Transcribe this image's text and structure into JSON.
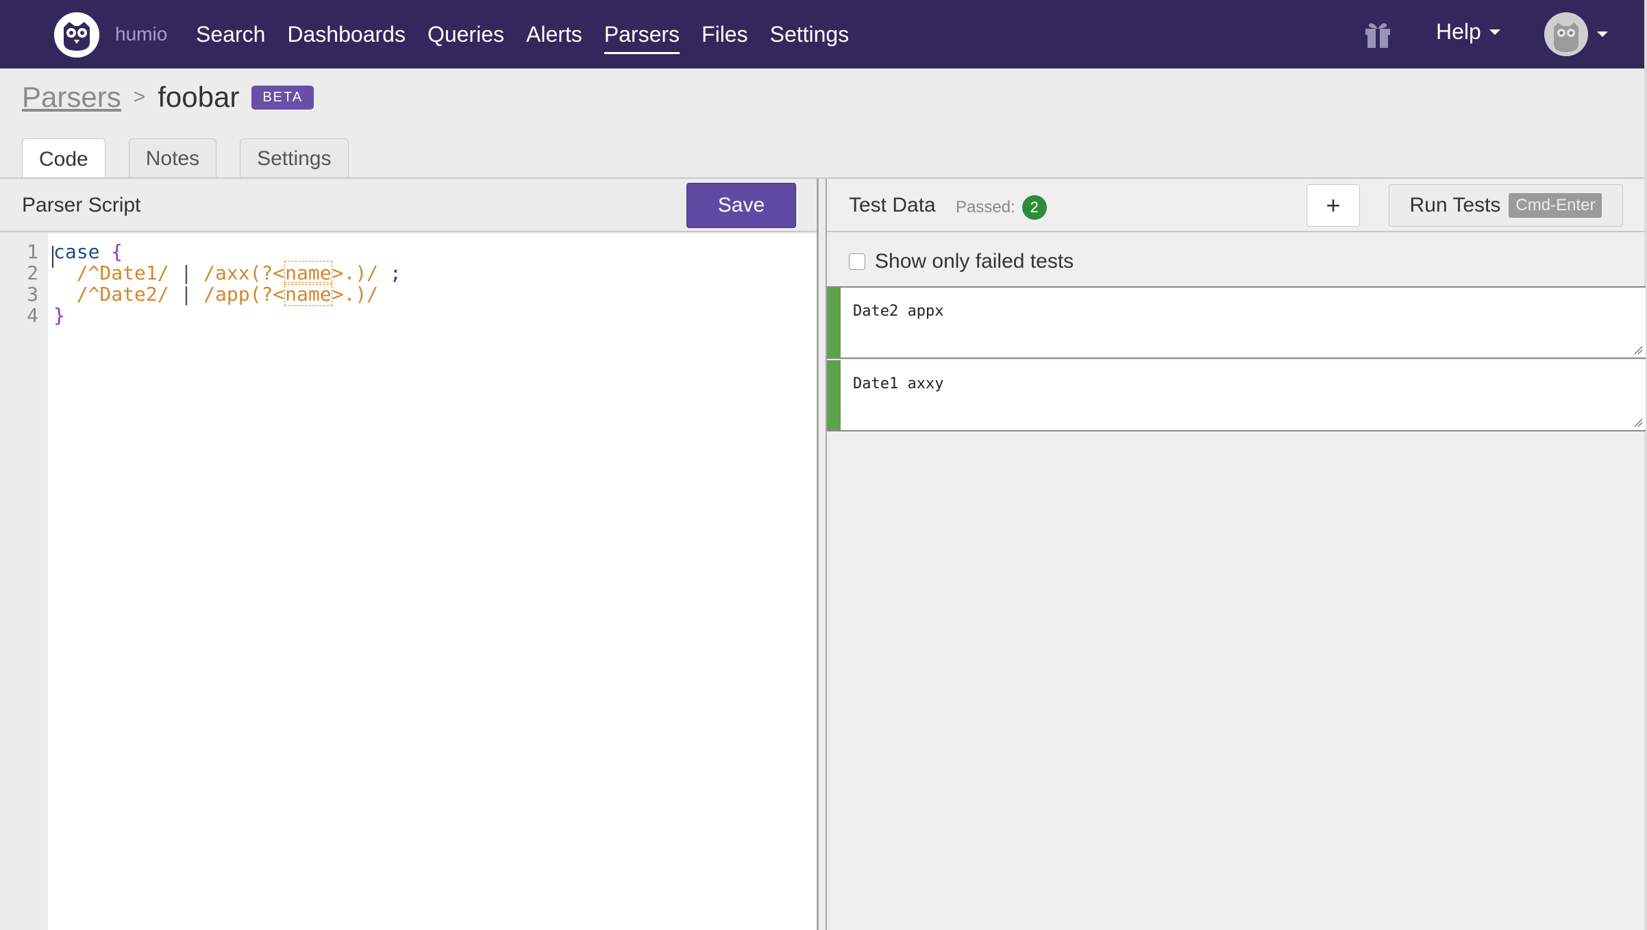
{
  "app": {
    "brand": "humio",
    "nav": [
      "Search",
      "Dashboards",
      "Queries",
      "Alerts",
      "Parsers",
      "Files",
      "Settings"
    ],
    "active_nav": "Parsers",
    "help_label": "Help"
  },
  "breadcrumb": {
    "parent": "Parsers",
    "separator": ">",
    "current": "foobar",
    "badge": "BETA"
  },
  "tabs": {
    "code": "Code",
    "notes": "Notes",
    "settings": "Settings",
    "active": "Code"
  },
  "editor": {
    "title": "Parser Script",
    "save_label": "Save",
    "line_numbers": [
      "1",
      "2",
      "3",
      "4"
    ],
    "lines": [
      "case {",
      "  /^Date1/ | /axx(?<name>.)/ ;",
      "  /^Date2/ | /app(?<name>.)/",
      "}"
    ]
  },
  "test_data": {
    "title": "Test Data",
    "passed_label": "Passed:",
    "passed_count": "2",
    "add_label": "+",
    "run_label": "Run Tests",
    "run_shortcut": "Cmd-Enter",
    "filter_label": "Show only failed tests",
    "filter_checked": false,
    "cases": [
      "Date2 appx",
      "Date1 axxy"
    ]
  },
  "colors": {
    "nav_bg": "#33285c",
    "accent": "#5e4aa3",
    "pass": "#5ea14e",
    "keyword": "#1f4e8c",
    "regex": "#d4862b",
    "brace": "#9b2fbf"
  }
}
